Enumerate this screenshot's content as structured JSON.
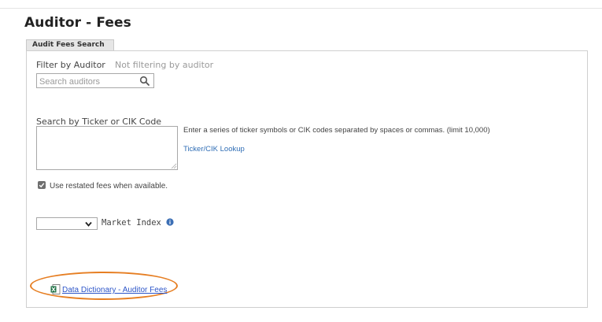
{
  "page": {
    "title": "Auditor - Fees"
  },
  "tab": {
    "label": "Audit Fees Search"
  },
  "auditor_filter": {
    "label": "Filter by Auditor",
    "status": "Not filtering by auditor",
    "search_placeholder": "Search auditors"
  },
  "ticker": {
    "label": "Search by Ticker or CIK Code",
    "help": "Enter a series of ticker symbols or CIK codes separated by spaces or commas. (limit 10,000)",
    "lookup_link": "Ticker/CIK Lookup"
  },
  "restated": {
    "label": "Use restated fees when available.",
    "checked": true
  },
  "market_index": {
    "label": "Market Index",
    "selected": ""
  },
  "data_dictionary": {
    "link": "Data Dictionary - Auditor Fees"
  },
  "colors": {
    "link": "#2c55c8",
    "highlight": "#e67e22",
    "excel_green": "#1e7145"
  }
}
